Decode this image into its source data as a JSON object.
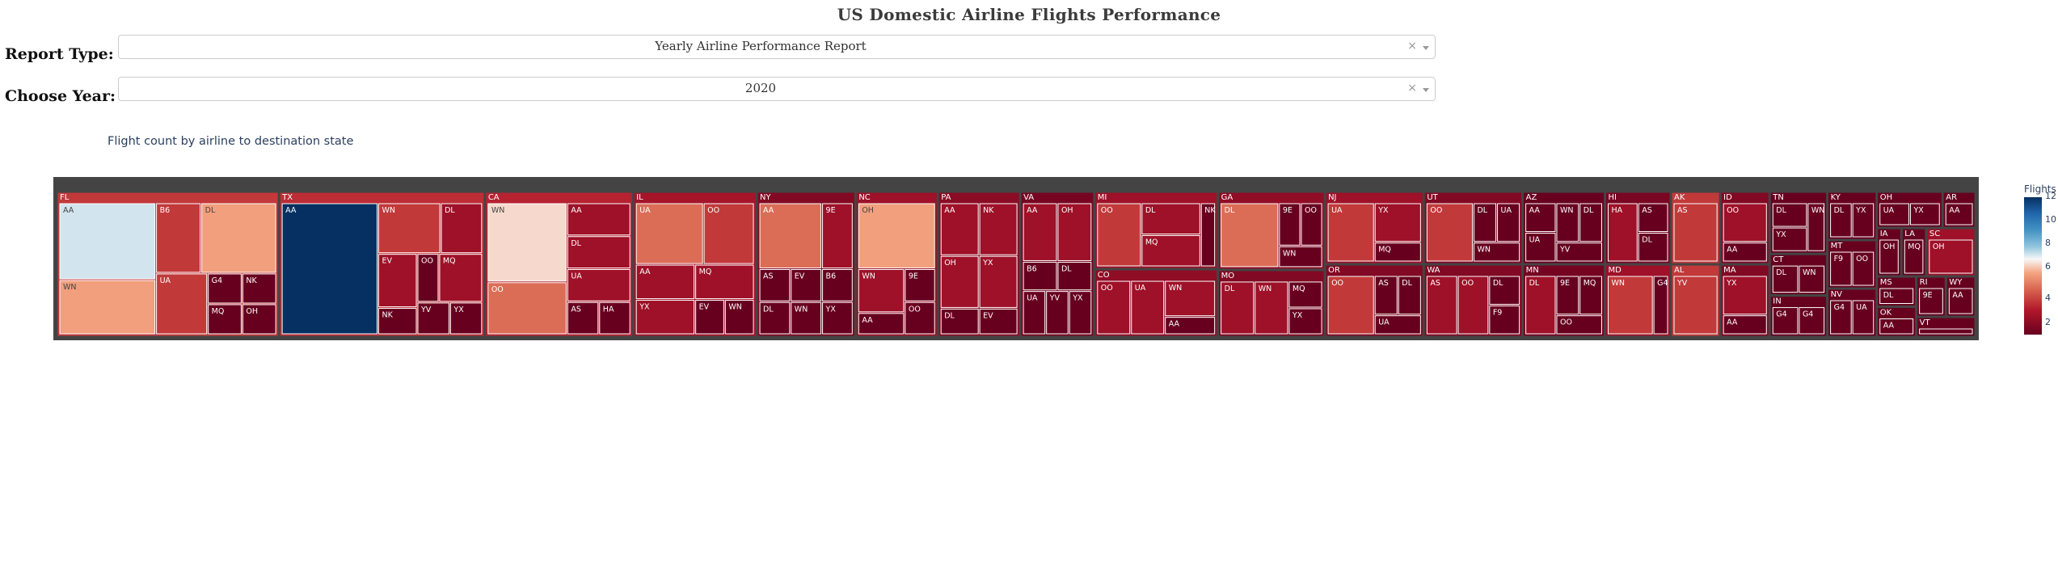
{
  "header": {
    "title": "US Domestic Airline Flights Performance"
  },
  "filters": {
    "report_type": {
      "label": "Report Type:",
      "value": "Yearly Airline Performance Report",
      "clear": "×"
    },
    "year": {
      "label": "Choose Year:",
      "value": "2020",
      "clear": "×"
    }
  },
  "chart_caption": "Flight count by airline to destination state",
  "colorbar": {
    "title": "Flights",
    "ticks": [
      "12",
      "10",
      "8",
      "6",
      "4",
      "2"
    ],
    "colors": [
      "#053061",
      "#2166ac",
      "#4393c3",
      "#92c5de",
      "#f7f7f7",
      "#f4a582",
      "#d6604d",
      "#b2182b",
      "#67001f"
    ]
  },
  "chart_data": {
    "type": "treemap",
    "title": "Flight count by airline to destination state",
    "color_scale": "RdBu",
    "color_range": [
      1,
      12
    ],
    "legend_title": "Flights",
    "states": [
      {
        "state": "FL",
        "airlines": [
          [
            "AA",
            7
          ],
          [
            "WN",
            5
          ],
          [
            "B6",
            3
          ],
          [
            "DL",
            5
          ],
          [
            "UA",
            3
          ],
          [
            "G4",
            1
          ],
          [
            "MQ",
            1
          ],
          [
            "NK",
            1
          ],
          [
            "OH",
            1
          ]
        ]
      },
      {
        "state": "TX",
        "airlines": [
          [
            "AA",
            12
          ],
          [
            "WN",
            3
          ],
          [
            "DL",
            2
          ],
          [
            "EV",
            2
          ],
          [
            "NK",
            1
          ],
          [
            "OO",
            1
          ],
          [
            "MQ",
            2
          ],
          [
            "YV",
            1
          ],
          [
            "YX",
            1
          ]
        ]
      },
      {
        "state": "CA",
        "airlines": [
          [
            "WN",
            6
          ],
          [
            "OO",
            4
          ],
          [
            "AA",
            2
          ],
          [
            "DL",
            2
          ],
          [
            "UA",
            2
          ],
          [
            "AS",
            1
          ],
          [
            "HA",
            1
          ]
        ]
      },
      {
        "state": "IL",
        "airlines": [
          [
            "UA",
            4
          ],
          [
            "OO",
            3
          ],
          [
            "AA",
            2
          ],
          [
            "YX",
            2
          ],
          [
            "MQ",
            2
          ],
          [
            "EV",
            1
          ],
          [
            "WN",
            1
          ]
        ]
      },
      {
        "state": "NY",
        "airlines": [
          [
            "AA",
            4
          ],
          [
            "9E",
            2
          ],
          [
            "AS",
            1
          ],
          [
            "DL",
            1
          ],
          [
            "EV",
            1
          ],
          [
            "B6",
            1
          ],
          [
            "WN",
            1
          ],
          [
            "YX",
            1
          ]
        ]
      },
      {
        "state": "NC",
        "airlines": [
          [
            "OH",
            5
          ],
          [
            "WN",
            2
          ],
          [
            "AA",
            1
          ],
          [
            "9E",
            1
          ],
          [
            "OO",
            1
          ]
        ]
      },
      {
        "state": "PA",
        "airlines": [
          [
            "AA",
            2
          ],
          [
            "NK",
            2
          ],
          [
            "OH",
            2
          ],
          [
            "YX",
            2
          ],
          [
            "DL",
            1
          ],
          [
            "EV",
            1
          ]
        ]
      },
      {
        "state": "VA",
        "airlines": [
          [
            "AA",
            2
          ],
          [
            "OH",
            2
          ],
          [
            "B6",
            1
          ],
          [
            "DL",
            1
          ],
          [
            "UA",
            1
          ],
          [
            "YV",
            1
          ],
          [
            "YX",
            1
          ]
        ]
      },
      {
        "state": "MI",
        "airlines": [
          [
            "OO",
            3
          ],
          [
            "DL",
            2
          ],
          [
            "MQ",
            2
          ],
          [
            "NK",
            1
          ]
        ]
      },
      {
        "state": "CO",
        "airlines": [
          [
            "OO",
            2
          ],
          [
            "UA",
            2
          ],
          [
            "WN",
            2
          ],
          [
            "AA",
            1
          ]
        ]
      },
      {
        "state": "GA",
        "airlines": [
          [
            "DL",
            4
          ],
          [
            "9E",
            1
          ],
          [
            "OO",
            1
          ],
          [
            "WN",
            1
          ]
        ]
      },
      {
        "state": "MO",
        "airlines": [
          [
            "DL",
            2
          ],
          [
            "WN",
            2
          ],
          [
            "MQ",
            1
          ],
          [
            "YX",
            1
          ]
        ]
      },
      {
        "state": "NJ",
        "airlines": [
          [
            "UA",
            3
          ],
          [
            "YX",
            2
          ],
          [
            "MQ",
            1
          ]
        ]
      },
      {
        "state": "OR",
        "airlines": [
          [
            "OO",
            3
          ],
          [
            "AS",
            1
          ],
          [
            "DL",
            1
          ],
          [
            "UA",
            1
          ]
        ]
      },
      {
        "state": "UT",
        "airlines": [
          [
            "OO",
            3
          ],
          [
            "DL",
            1
          ],
          [
            "UA",
            1
          ],
          [
            "WN",
            1
          ]
        ]
      },
      {
        "state": "WA",
        "airlines": [
          [
            "AS",
            2
          ],
          [
            "OO",
            2
          ],
          [
            "DL",
            1
          ],
          [
            "F9",
            1
          ]
        ]
      },
      {
        "state": "AZ",
        "airlines": [
          [
            "AA",
            1
          ],
          [
            "UA",
            1
          ],
          [
            "WN",
            1
          ],
          [
            "DL",
            1
          ],
          [
            "YV",
            1
          ]
        ]
      },
      {
        "state": "MN",
        "airlines": [
          [
            "DL",
            2
          ],
          [
            "9E",
            1
          ],
          [
            "MQ",
            1
          ],
          [
            "OO",
            1
          ]
        ]
      },
      {
        "state": "HI",
        "airlines": [
          [
            "HA",
            2
          ],
          [
            "AS",
            1
          ],
          [
            "DL",
            1
          ]
        ]
      },
      {
        "state": "MD",
        "airlines": [
          [
            "WN",
            3
          ],
          [
            "G4",
            1
          ]
        ]
      },
      {
        "state": "AK",
        "airlines": [
          [
            "AS",
            3
          ]
        ]
      },
      {
        "state": "AL",
        "airlines": [
          [
            "YV",
            3
          ]
        ]
      },
      {
        "state": "ID",
        "airlines": [
          [
            "OO",
            2
          ],
          [
            "AA",
            1
          ]
        ]
      },
      {
        "state": "MA",
        "airlines": [
          [
            "YX",
            2
          ],
          [
            "AA",
            1
          ]
        ]
      },
      {
        "state": "TN",
        "airlines": [
          [
            "DL",
            1
          ],
          [
            "YX",
            1
          ],
          [
            "WN",
            1
          ]
        ]
      },
      {
        "state": "CT",
        "airlines": [
          [
            "DL",
            1
          ],
          [
            "WN",
            1
          ]
        ]
      },
      {
        "state": "IN",
        "airlines": [
          [
            "G4",
            1
          ],
          [
            "G4",
            1
          ]
        ]
      },
      {
        "state": "KY",
        "airlines": [
          [
            "DL",
            1
          ],
          [
            "YX",
            1
          ]
        ]
      },
      {
        "state": "MT",
        "airlines": [
          [
            "F9",
            1
          ],
          [
            "OO",
            1
          ]
        ]
      },
      {
        "state": "NV",
        "airlines": [
          [
            "G4",
            1
          ],
          [
            "UA",
            1
          ]
        ]
      },
      {
        "state": "OH",
        "airlines": [
          [
            "UA",
            1
          ],
          [
            "YX",
            1
          ]
        ]
      },
      {
        "state": "AR",
        "airlines": [
          [
            "AA",
            1
          ]
        ]
      },
      {
        "state": "IA",
        "airlines": [
          [
            "OH",
            1
          ]
        ]
      },
      {
        "state": "LA",
        "airlines": [
          [
            "MQ",
            1
          ]
        ]
      },
      {
        "state": "SC",
        "airlines": [
          [
            "OH",
            2
          ]
        ]
      },
      {
        "state": "MS",
        "airlines": [
          [
            "DL",
            1
          ]
        ]
      },
      {
        "state": "OK",
        "airlines": [
          [
            "AA",
            1
          ]
        ]
      },
      {
        "state": "RI",
        "airlines": [
          [
            "9E",
            1
          ]
        ]
      },
      {
        "state": "WY",
        "airlines": [
          [
            "AA",
            1
          ]
        ]
      },
      {
        "state": "VT",
        "airlines": [
          [
            "9E",
            1
          ]
        ]
      }
    ]
  }
}
